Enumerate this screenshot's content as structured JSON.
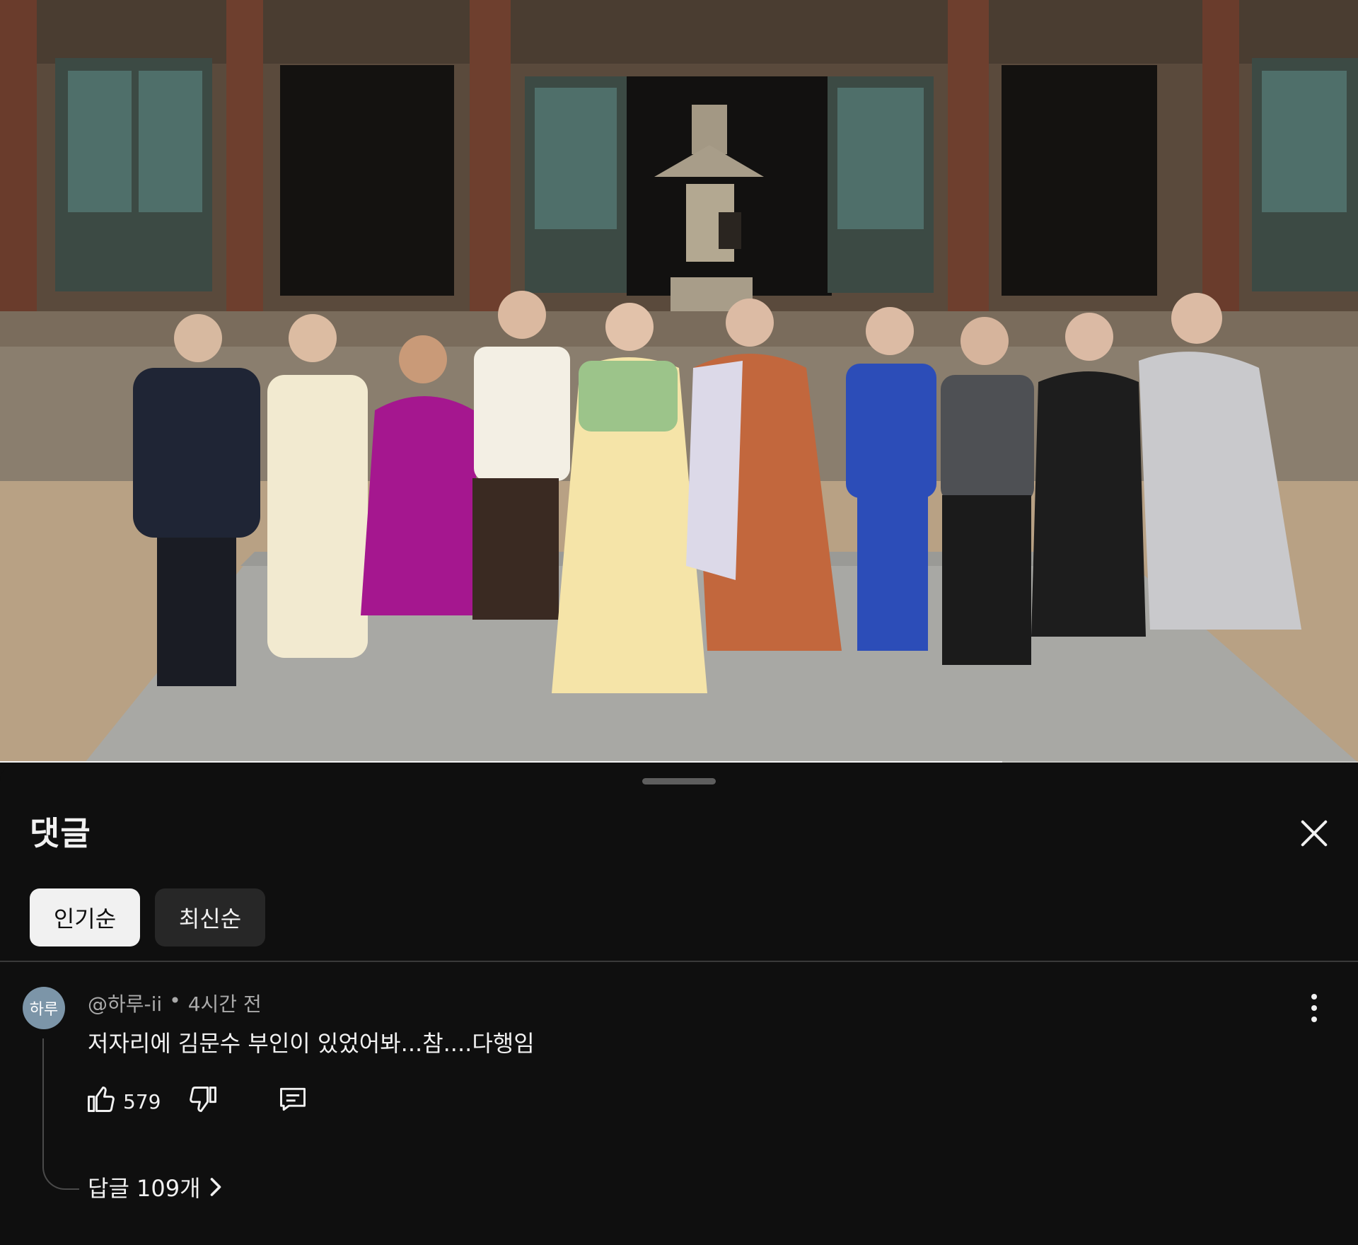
{
  "video": {
    "progress_percent": 73.8
  },
  "comments_panel": {
    "title": "댓글",
    "close_icon": "close-icon",
    "sort_chips": [
      {
        "label": "인기순",
        "selected": true
      },
      {
        "label": "최신순",
        "selected": false
      }
    ]
  },
  "comment": {
    "avatar_text": "하루",
    "author": "@하루-ii",
    "separator": "•",
    "time": "4시간 전",
    "text": "저자리에 김문수 부인이 있었어봐...참....다행임",
    "like_count": "579",
    "replies_label": "답글 109개"
  },
  "colors": {
    "background": "#0f0f0f",
    "chip_selected_bg": "#f1f1f1",
    "chip_bg": "#272727",
    "text_primary": "#f1f1f1",
    "text_secondary": "#aaaaaa",
    "avatar_bg": "#7c95a8"
  }
}
